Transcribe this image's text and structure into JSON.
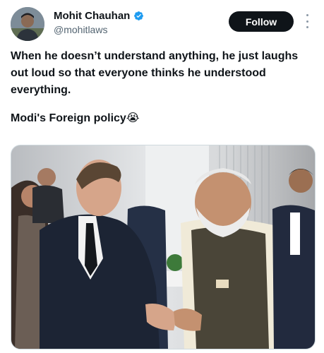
{
  "author": {
    "display_name": "Mohit Chauhan",
    "handle": "@mohitlaws",
    "verified": true,
    "verified_color": "#1d9bf0"
  },
  "actions": {
    "follow_label": "Follow",
    "more_icon": "more-vertical-icon"
  },
  "tweet": {
    "text_line_1": "When he doesn’t understand anything, he just laughs out loud so that everyone thinks he understood everything.",
    "text_line_2": "Modi's Foreign policy😭"
  },
  "media": {
    "type": "photo"
  },
  "colors": {
    "follow_bg": "#0f1419",
    "text": "#0f1419",
    "secondary_text": "#536471"
  }
}
